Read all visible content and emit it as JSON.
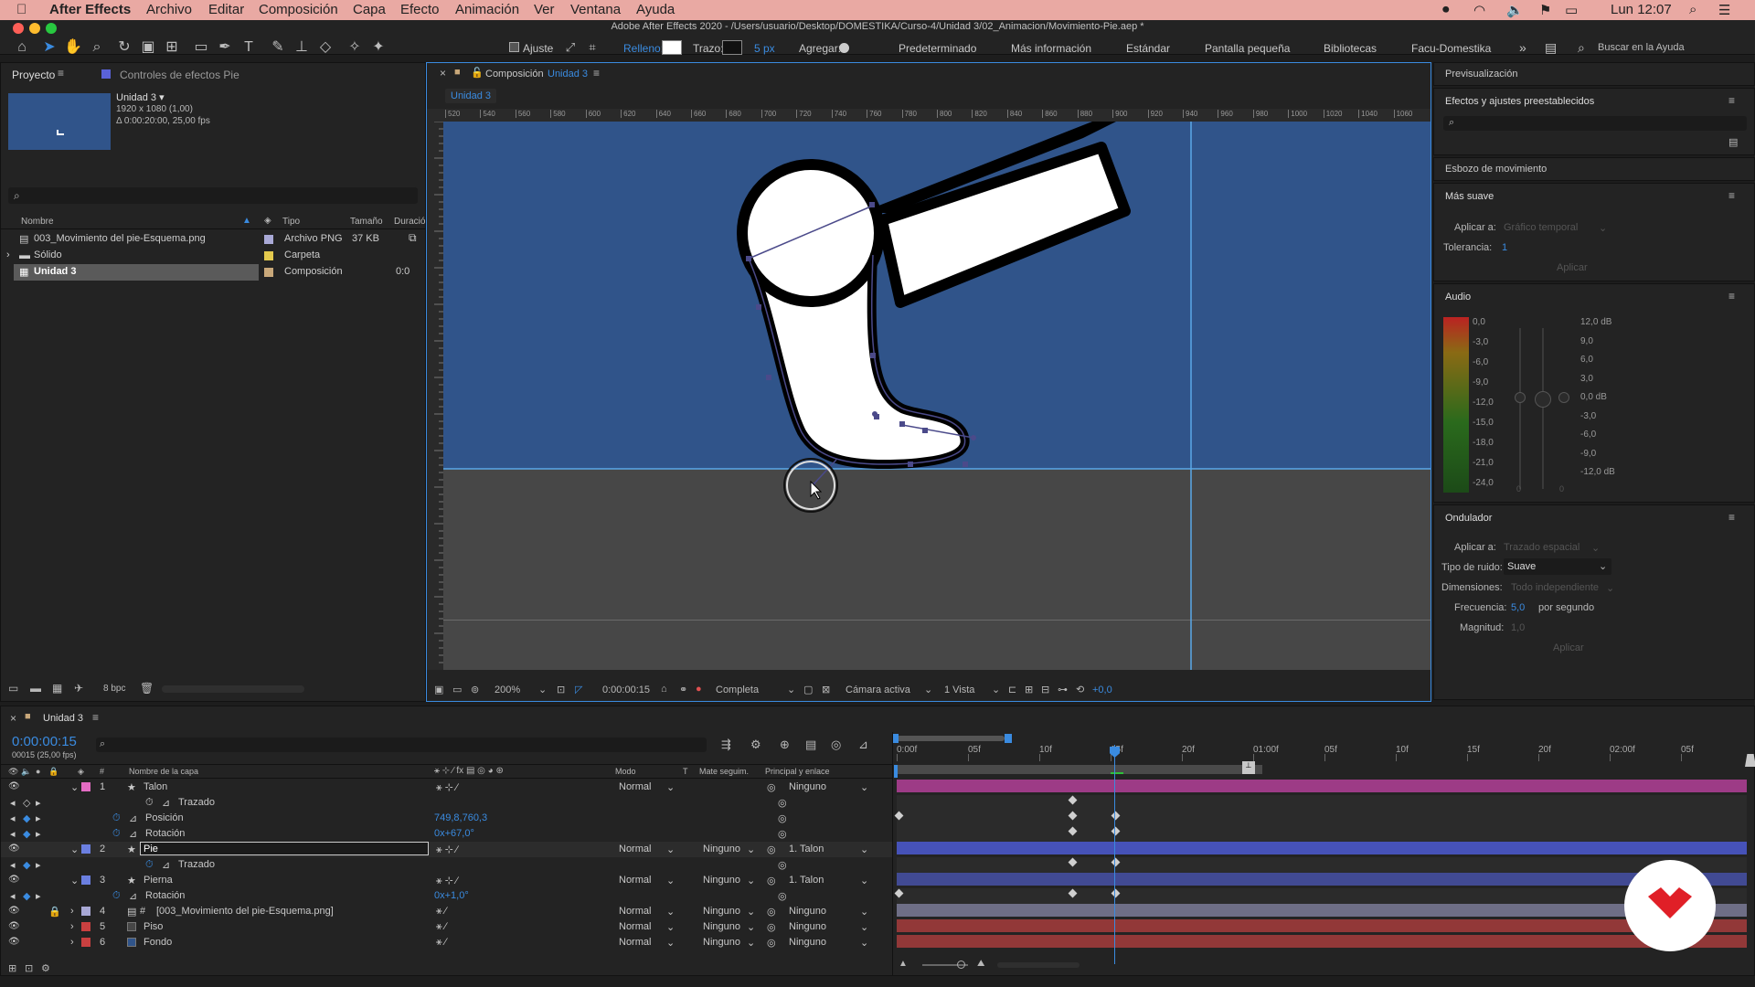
{
  "menubar": {
    "app": "After Effects",
    "items": [
      "Archivo",
      "Editar",
      "Composición",
      "Capa",
      "Efecto",
      "Animación",
      "Ver",
      "Ventana",
      "Ayuda"
    ],
    "clock": "Lun 12:07"
  },
  "window_title": "Adobe After Effects 2020 - /Users/usuario/Desktop/DOMESTIKA/Curso-4/Unidad 3/02_Animacion/Movimiento-Pie.aep *",
  "toolbar": {
    "ajuste": "Ajuste",
    "relleno": "Relleno:",
    "trazo": "Trazo:",
    "trazo_px": "5 px",
    "agregar": "Agregar:",
    "workspaces": [
      "Predeterminado",
      "Más información",
      "Estándar",
      "Pantalla pequeña",
      "Bibliotecas",
      "Facu-Domestika"
    ],
    "search_placeholder": "Buscar en la Ayuda"
  },
  "project": {
    "tab": "Proyecto",
    "tab2": "Controles de efectos Pie",
    "comp_name": "Unidad 3 ▾",
    "comp_size": "1920 x 1080 (1,00)",
    "comp_dur": "Δ 0:00:20:00, 25,00 fps",
    "cols": [
      "Nombre",
      "Tipo",
      "Tamaño",
      "Duració"
    ],
    "items": [
      {
        "name": "003_Movimiento del pie-Esquema.png",
        "type": "Archivo PNG",
        "size": "37 KB",
        "color": "#a9a9d6"
      },
      {
        "name": "Sólido",
        "type": "Carpeta",
        "size": "",
        "color": "#e3c94d"
      },
      {
        "name": "Unidad 3",
        "type": "Composición",
        "size": "0:0",
        "color": "#c9a87a"
      }
    ],
    "bpc": "8 bpc"
  },
  "comp": {
    "tab": "Composición",
    "tab_name": "Unidad 3",
    "subtab": "Unidad 3",
    "ruler_ticks": [
      "520",
      "540",
      "560",
      "580",
      "600",
      "620",
      "640",
      "660",
      "680",
      "700",
      "720",
      "740",
      "760",
      "780",
      "800",
      "820",
      "840",
      "860",
      "880",
      "900",
      "920",
      "940",
      "960",
      "980",
      "1000",
      "1020",
      "1040",
      "1060"
    ],
    "zoom": "200%",
    "time": "0:00:00:15",
    "quality": "Completa",
    "camera": "Cámara activa",
    "views": "1 Vista",
    "exposure": "+0,0"
  },
  "right": {
    "preview": "Previsualización",
    "effects": "Efectos y ajustes preestablecidos",
    "sketch": "Esbozo de movimiento",
    "smoother": "Más suave",
    "apply_to": "Aplicar a:",
    "apply_to_val": "Gráfico temporal",
    "tolerance": "Tolerancia:",
    "tolerance_val": "1",
    "apply": "Aplicar",
    "audio": "Audio",
    "audio_left": [
      "0,0",
      "-3,0",
      "-6,0",
      "-9,0",
      "-12,0",
      "-15,0",
      "-18,0",
      "-21,0",
      "-24,0"
    ],
    "audio_right": [
      "12,0 dB",
      "9,0",
      "6,0",
      "3,0",
      "0,0 dB",
      "-3,0",
      "-6,0",
      "-9,0",
      "-12,0 dB"
    ],
    "audio_bottom": [
      "0",
      "0"
    ],
    "wiggler": "Ondulador",
    "w_apply": "Aplicar a:",
    "w_apply_val": "Trazado espacial",
    "noise": "Tipo de ruido:",
    "noise_val": "Suave",
    "dims": "Dimensiones:",
    "dims_val": "Todo independiente",
    "freq": "Frecuencia:",
    "freq_val": "5,0",
    "freq_unit": "por segundo",
    "mag": "Magnitud:",
    "mag_val": "1,0",
    "w_apply_btn": "Aplicar"
  },
  "timeline": {
    "tab": "Unidad 3",
    "time": "0:00:00:15",
    "frames": "00015 (25,00 fps)",
    "cols": {
      "num": "#",
      "name": "Nombre de la capa",
      "mode": "Modo",
      "t": "T",
      "matte": "Mate seguim.",
      "parent": "Principal y enlace"
    },
    "ruler": [
      "0:00f",
      "05f",
      "10f",
      "15f",
      "20f",
      "01:00f",
      "05f",
      "10f",
      "15f",
      "20f",
      "02:00f",
      "05f"
    ],
    "rows": [
      {
        "type": "layer",
        "num": "1",
        "name": "Talon",
        "color": "#e36cc3",
        "mode": "Normal",
        "matte": "",
        "parent": "Ninguno"
      },
      {
        "type": "prop",
        "name": "Trazado",
        "value": ""
      },
      {
        "type": "prop",
        "name": "Posición",
        "value": "749,8,760,3"
      },
      {
        "type": "prop",
        "name": "Rotación",
        "value": "0x+67,0°"
      },
      {
        "type": "layer",
        "num": "2",
        "name": "Pie",
        "color": "#6b7fe0",
        "mode": "Normal",
        "matte": "Ninguno",
        "parent": "1. Talon"
      },
      {
        "type": "prop",
        "name": "Trazado",
        "value": ""
      },
      {
        "type": "layer",
        "num": "3",
        "name": "Pierna",
        "color": "#6b7fe0",
        "mode": "Normal",
        "matte": "Ninguno",
        "parent": "1. Talon"
      },
      {
        "type": "prop",
        "name": "Rotación",
        "value": "0x+1,0°"
      },
      {
        "type": "layer",
        "num": "4",
        "name": "[003_Movimiento del pie-Esquema.png]",
        "color": "#a9a9d6",
        "mode": "Normal",
        "matte": "Ninguno",
        "parent": "Ninguno"
      },
      {
        "type": "layer",
        "num": "5",
        "name": "Piso",
        "color": "#c94040",
        "mode": "Normal",
        "matte": "Ninguno",
        "parent": "Ninguno"
      },
      {
        "type": "layer",
        "num": "6",
        "name": "Fondo",
        "color": "#c94040",
        "mode": "Normal",
        "matte": "Ninguno",
        "parent": "Ninguno"
      }
    ]
  },
  "colors": {
    "comp_bg": "#30548a",
    "floor": "#474747",
    "accent": "#3a8be0"
  }
}
